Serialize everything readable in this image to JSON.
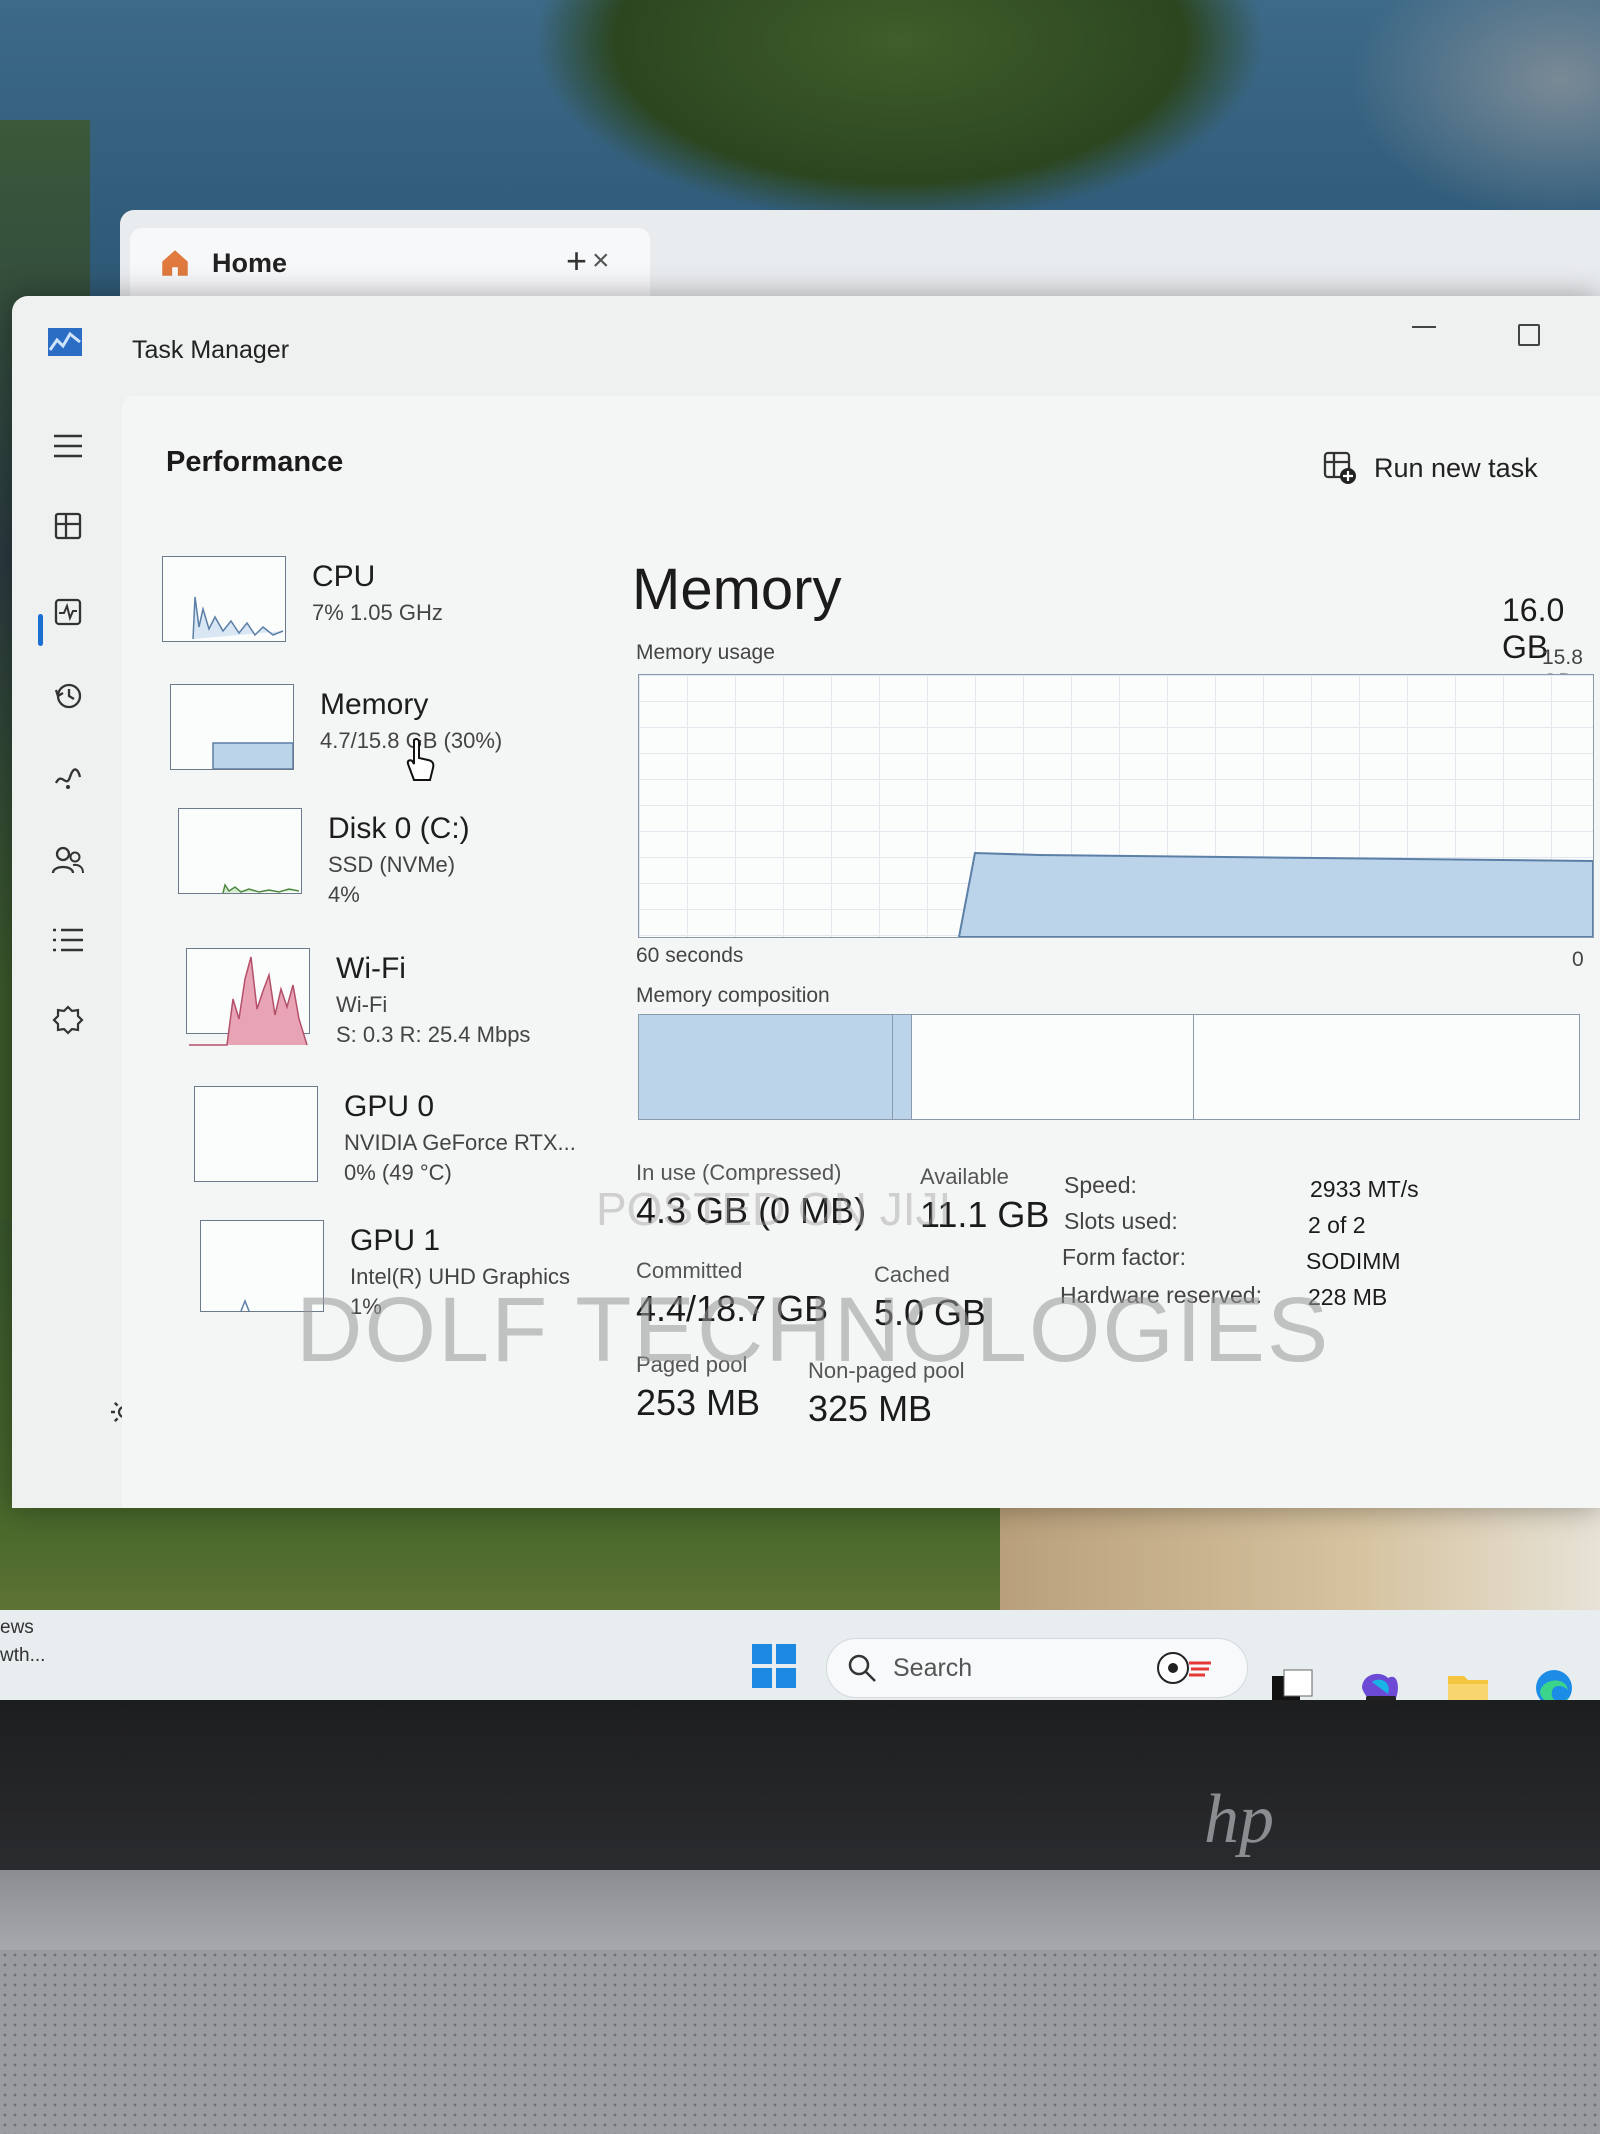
{
  "browser": {
    "tab_label": "Home",
    "close_glyph": "×",
    "add_glyph": "+"
  },
  "window": {
    "title": "Task Manager"
  },
  "nav": {
    "page_title": "Performance",
    "run_new_task": "Run new task",
    "rail_icons": [
      "hamburger-menu-icon",
      "processes-icon",
      "performance-icon",
      "app-history-icon",
      "startup-apps-icon",
      "users-icon",
      "details-icon",
      "services-icon"
    ]
  },
  "devices": [
    {
      "name": "CPU",
      "line2": "7% 1.05 GHz",
      "line3": ""
    },
    {
      "name": "Memory",
      "line2": "4.7/15.8 GB (30%)",
      "line3": ""
    },
    {
      "name": "Disk 0 (C:)",
      "line2": "SSD (NVMe)",
      "line3": "4%"
    },
    {
      "name": "Wi-Fi",
      "line2": "Wi-Fi",
      "line3": "S: 0.3 R: 25.4 Mbps"
    },
    {
      "name": "GPU 0",
      "line2": "NVIDIA GeForce RTX...",
      "line3": "0% (49 °C)"
    },
    {
      "name": "GPU 1",
      "line2": "Intel(R) UHD Graphics",
      "line3": "1%"
    }
  ],
  "memory": {
    "title": "Memory",
    "total": "16.0 GB",
    "usage_label": "Memory usage",
    "usage_max": "15.8 GB",
    "time_left": "60 seconds",
    "time_right": "0",
    "composition_label": "Memory composition",
    "composition_fractions": {
      "in_use": 0.27,
      "modified": 0.02,
      "standby": 0.3
    },
    "in_use_label": "In use (Compressed)",
    "in_use_value": "4.3 GB (0 MB)",
    "available_label": "Available",
    "available_value": "11.1 GB",
    "committed_label": "Committed",
    "committed_value": "4.4/18.7 GB",
    "cached_label": "Cached",
    "cached_value": "5.0 GB",
    "paged_label": "Paged pool",
    "paged_value": "253 MB",
    "nonpaged_label": "Non-paged pool",
    "nonpaged_value": "325 MB",
    "speed_label": "Speed:",
    "speed_value": "2933 MT/s",
    "slots_label": "Slots used:",
    "slots_value": "2 of 2",
    "form_label": "Form factor:",
    "form_value": "SODIMM",
    "hw_label": "Hardware reserved:",
    "hw_value": "228 MB"
  },
  "watermark": {
    "main": "DOLF TECHNOLOGIES",
    "small": "POSTED ON JIJI"
  },
  "taskbar": {
    "news_line1": "ews",
    "news_line2": "wth...",
    "search_placeholder": "Search"
  },
  "laptop": {
    "logo": "hp"
  },
  "colors": {
    "accent": "#1a6fd1",
    "memory_fill": "#bcd4ea",
    "wifi_fill": "#e8a3b4"
  }
}
